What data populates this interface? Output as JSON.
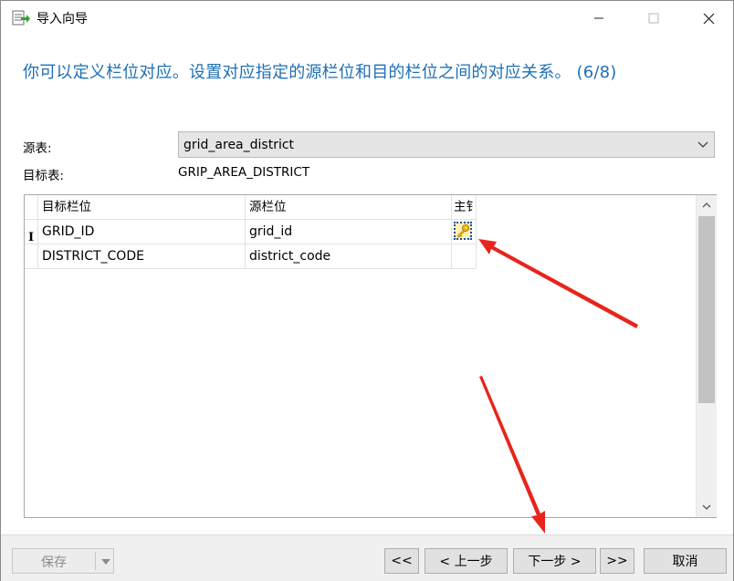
{
  "window": {
    "title": "导入向导",
    "icons": {
      "app": "import-table-icon",
      "minimize": "minimize-icon",
      "maximize": "maximize-icon",
      "close": "close-icon"
    }
  },
  "header": {
    "text": "你可以定义栏位对应。设置对应指定的源栏位和目的栏位之间的对应关系。 (6/8)"
  },
  "form": {
    "source_label": "源表:",
    "source_value": "grid_area_district",
    "target_label": "目标表:",
    "target_value": "GRIP_AREA_DISTRICT"
  },
  "grid": {
    "columns": [
      "目标栏位",
      "源栏位",
      "主键"
    ],
    "columns_visible": [
      "目标栏位",
      "源栏位",
      "主钅"
    ],
    "rows": [
      {
        "indicator": "I",
        "target": "GRID_ID",
        "source": "grid_id",
        "primary_key": true
      },
      {
        "indicator": "",
        "target": "DISTRICT_CODE",
        "source": "district_code",
        "primary_key": false
      }
    ]
  },
  "footer": {
    "save": "保存",
    "first": "<<",
    "prev": "< 上一步",
    "next": "下一步 >",
    "last": ">>",
    "cancel": "取消"
  },
  "colors": {
    "accent": "#1e6fb6",
    "annotation_arrow": "#e8241c",
    "key_icon": "#f0b400"
  }
}
